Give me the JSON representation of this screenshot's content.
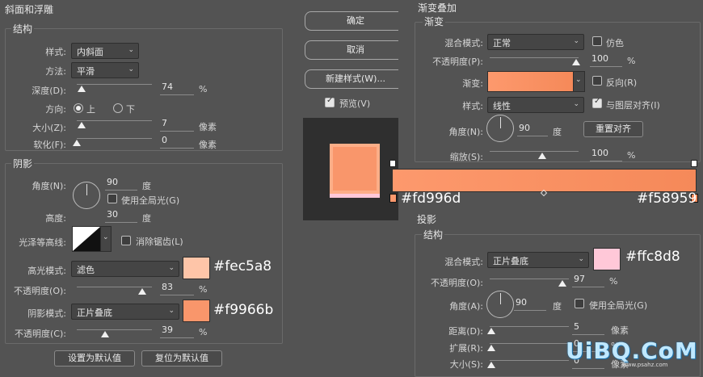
{
  "bevel": {
    "section_title": "斜面和浮雕",
    "structure_title": "结构",
    "style_label": "样式:",
    "style_value": "内斜面",
    "technique_label": "方法:",
    "technique_value": "平滑",
    "depth_label": "深度(D):",
    "depth_value": "74",
    "depth_unit": "%",
    "direction_label": "方向:",
    "direction_up": "上",
    "direction_down": "下",
    "size_label": "大小(Z):",
    "size_value": "7",
    "size_unit": "像素",
    "soften_label": "软化(F):",
    "soften_value": "0",
    "soften_unit": "像素"
  },
  "shading": {
    "section_title": "阴影",
    "angle_label": "角度(N):",
    "angle_value": "90",
    "angle_unit": "度",
    "global_light_label": "使用全局光(G)",
    "altitude_label": "高度:",
    "altitude_value": "30",
    "altitude_unit": "度",
    "gloss_label": "光泽等高线:",
    "antialias_label": "消除锯齿(L)",
    "highlight_mode_label": "高光模式:",
    "highlight_mode_value": "滤色",
    "highlight_color": "#fec5a8",
    "highlight_hex": "#fec5a8",
    "highlight_opacity_label": "不透明度(O):",
    "highlight_opacity_value": "83",
    "highlight_opacity_unit": "%",
    "shadow_mode_label": "阴影模式:",
    "shadow_mode_value": "正片叠底",
    "shadow_color": "#f9966b",
    "shadow_hex": "#f9966b",
    "shadow_opacity_label": "不透明度(C):",
    "shadow_opacity_value": "39",
    "shadow_opacity_unit": "%",
    "make_default": "设置为默认值",
    "reset_default": "复位为默认值"
  },
  "dialog": {
    "ok": "确定",
    "cancel": "取消",
    "new_style": "新建样式(W)...",
    "preview": "预览(V)"
  },
  "gradient_overlay": {
    "header": "渐变叠加",
    "section_title": "渐变",
    "blend_label": "混合模式:",
    "blend_value": "正常",
    "dither_label": "仿色",
    "opacity_label": "不透明度(P):",
    "opacity_value": "100",
    "opacity_unit": "%",
    "gradient_label": "渐变:",
    "reverse_label": "反向(R)",
    "style_label": "样式:",
    "style_value": "线性",
    "align_label": "与图层对齐(I)",
    "angle_label": "角度(N):",
    "angle_value": "90",
    "angle_unit": "度",
    "reset_align": "重置对齐",
    "scale_label": "缩放(S):",
    "scale_value": "100",
    "scale_unit": "%",
    "color_left": "#fd996d",
    "color_right": "#f58959",
    "stop_left_hex": "#fd996d",
    "stop_right_hex": "#f58959"
  },
  "drop_shadow": {
    "section_title": "投影",
    "structure_title": "结构",
    "blend_label": "混合模式:",
    "blend_value": "正片叠底",
    "color": "#ffc8d8",
    "color_hex": "#ffc8d8",
    "opacity_label": "不透明度(O):",
    "opacity_value": "97",
    "opacity_unit": "%",
    "angle_label": "角度(A):",
    "angle_value": "90",
    "angle_unit": "度",
    "global_light_label": "使用全局光(G)",
    "distance_label": "距离(D):",
    "distance_value": "5",
    "distance_unit": "像素",
    "spread_label": "扩展(R):",
    "spread_value": "0",
    "spread_unit": "%",
    "size_label": "大小(S):",
    "size_value": "0",
    "size_unit": "像素"
  },
  "watermark": "UiBQ.CoM",
  "watermark_sub": "www.psahz.com"
}
